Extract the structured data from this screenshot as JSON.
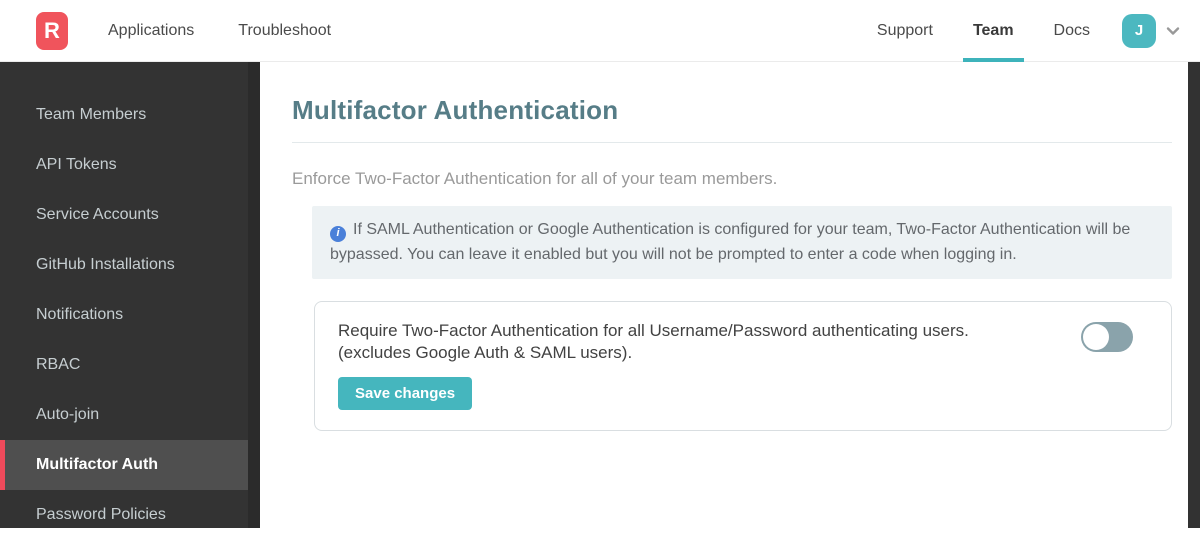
{
  "navbar": {
    "logo_letter": "R",
    "left_items": [
      "Applications",
      "Troubleshoot"
    ],
    "right_items": [
      "Support",
      "Team",
      "Docs"
    ],
    "active_right_item": "Team",
    "avatar_initial": "J"
  },
  "sidebar": {
    "items": [
      "Team Members",
      "API Tokens",
      "Service Accounts",
      "GitHub Installations",
      "Notifications",
      "RBAC",
      "Auto-join",
      "Multifactor Auth",
      "Password Policies"
    ],
    "active_item": "Multifactor Auth"
  },
  "main": {
    "title": "Multifactor Authentication",
    "description": "Enforce Two-Factor Authentication for all of your team members.",
    "info_note": "If SAML Authentication or Google Authentication is configured for your team, Two-Factor Authentication will be bypassed. You can leave it enabled but you will not be prompted to enter a code when logging in.",
    "setting": {
      "label_line1": "Require Two-Factor Authentication for all Username/Password authenticating users.",
      "label_line2": "(excludes Google Auth & SAML users).",
      "toggle_state": "off",
      "save_button_label": "Save changes"
    }
  },
  "icons": {
    "info_icon_glyph": "i",
    "chevron_down_icon": "chevron-down",
    "logo_icon": "rollbar-r-logo"
  },
  "colors": {
    "brand_red": "#f0545c",
    "accent_teal": "#45b6be",
    "nav_underline_teal": "#3db3bb",
    "avatar_teal": "#4cb8c0",
    "heading_teal": "#567d87",
    "info_icon_blue": "#4a80d9",
    "info_box_bg": "#edf2f4",
    "sidebar_bg": "#333333",
    "sidebar_active_bg": "#4f4f4f",
    "sidebar_active_accent": "#ef4a5b",
    "toggle_off": "#8aa3ab"
  }
}
